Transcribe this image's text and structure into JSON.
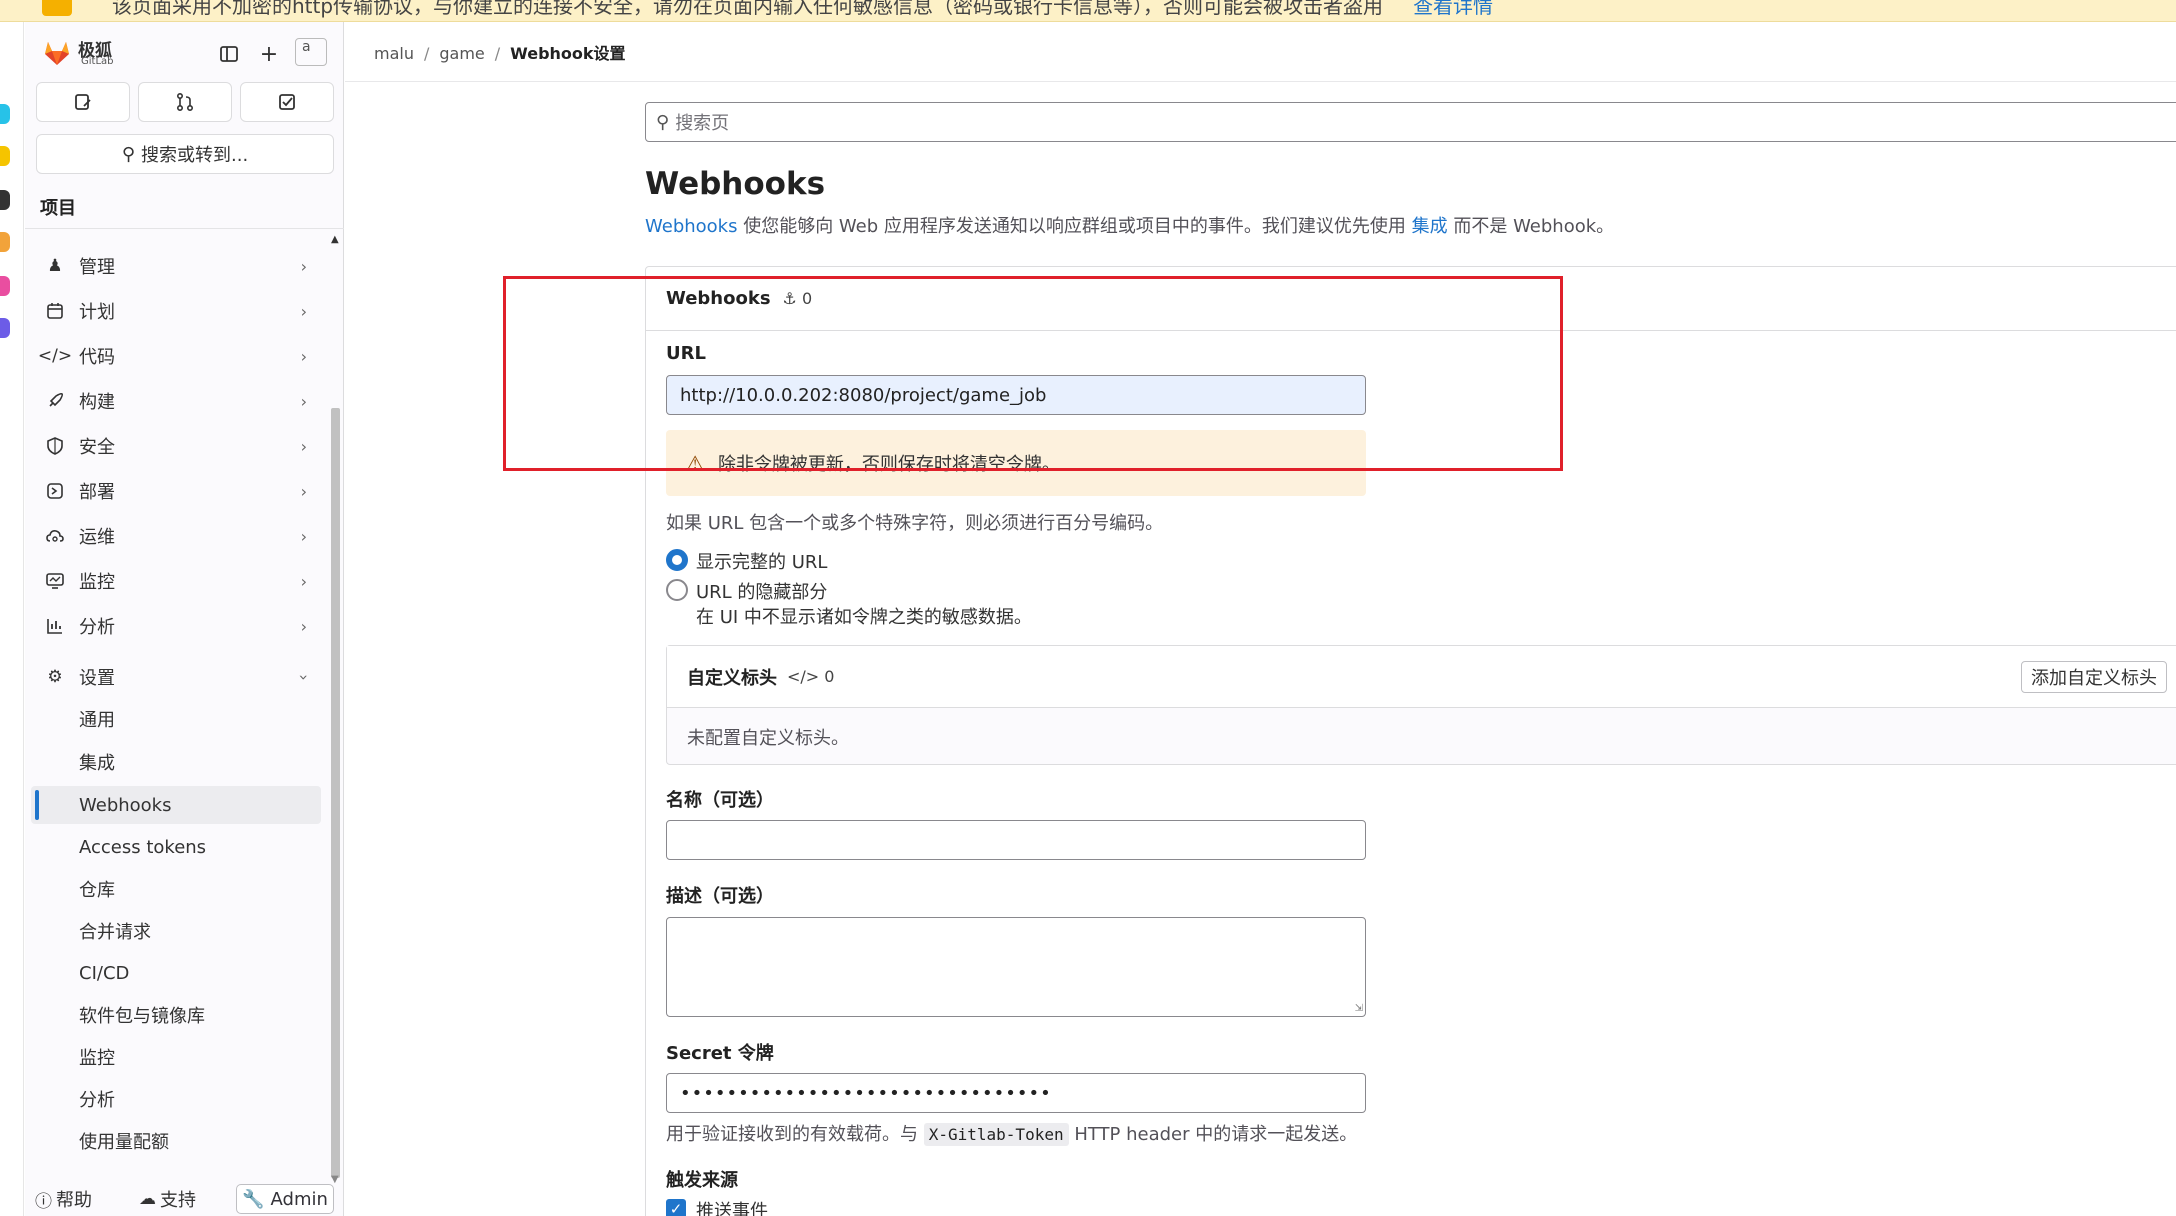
{
  "banner": {
    "text": "该页面采用不加密的http传输协议，与你建立的连接不安全，请勿在页面内输入任何敏感信息（密码或银行卡信息等），否则可能会被攻击者盗用",
    "link": "查看详情"
  },
  "sidebar": {
    "brand": "极狐",
    "brand_sub": "GitLab",
    "avatar_alt": "a",
    "search": "搜索或转到...",
    "section_title": "项目",
    "items": [
      {
        "label": "管理",
        "icon": "users-icon"
      },
      {
        "label": "计划",
        "icon": "calendar-icon"
      },
      {
        "label": "代码",
        "icon": "code-icon"
      },
      {
        "label": "构建",
        "icon": "rocket-icon"
      },
      {
        "label": "安全",
        "icon": "shield-icon"
      },
      {
        "label": "部署",
        "icon": "deploy-icon"
      },
      {
        "label": "运维",
        "icon": "cloud-gear-icon"
      },
      {
        "label": "监控",
        "icon": "monitor-icon"
      },
      {
        "label": "分析",
        "icon": "chart-icon"
      },
      {
        "label": "设置",
        "icon": "gear-icon"
      }
    ],
    "settings_sub": [
      "通用",
      "集成",
      "Webhooks",
      "Access tokens",
      "仓库",
      "合并请求",
      "CI/CD",
      "软件包与镜像库",
      "监控",
      "分析",
      "使用量配额"
    ],
    "help": "帮助",
    "support": "支持",
    "admin": "Admin"
  },
  "breadcrumb": [
    "malu",
    "game",
    "Webhook设置"
  ],
  "search_placeholder": "搜索页",
  "page": {
    "title": "Webhooks",
    "desc_link1": "Webhooks",
    "desc_mid": " 使您能够向 Web 应用程序发送通知以响应群组或项目中的事件。我们建议优先使用 ",
    "desc_link2": "集成",
    "desc_end": " 而不是 Webhook。"
  },
  "card": {
    "title": "Webhooks",
    "count": "0"
  },
  "form": {
    "url_label": "URL",
    "url_value": "http://10.0.0.202:8080/project/game_job",
    "alert": "除非令牌被更新，否则保存时将清空令牌。",
    "url_help": "如果 URL 包含一个或多个特殊字符，则必须进行百分号编码。",
    "radio_full": "显示完整的 URL",
    "radio_mask": "URL 的隐藏部分",
    "radio_mask_help": "在 UI 中不显示诸如令牌之类的敏感数据。",
    "custom_headers_title": "自定义标头",
    "custom_headers_count": "0",
    "add_header": "添加自定义标头",
    "no_headers": "未配置自定义标头。",
    "name_label": "名称（可选）",
    "desc_label": "描述（可选）",
    "secret_label": "Secret 令牌",
    "secret_value": "••••••••••••••••••••••••••••••••",
    "secret_help_pre": "用于验证接收到的有效载荷。与 ",
    "secret_help_code": "X-Gitlab-Token",
    "secret_help_post": " HTTP header 中的请求一起发送。",
    "trigger_label": "触发来源",
    "push_events": "推送事件"
  },
  "colors": {
    "accent": "#1f75cb",
    "annotation": "#e0202a",
    "alert_bg": "#fdf1dd"
  }
}
